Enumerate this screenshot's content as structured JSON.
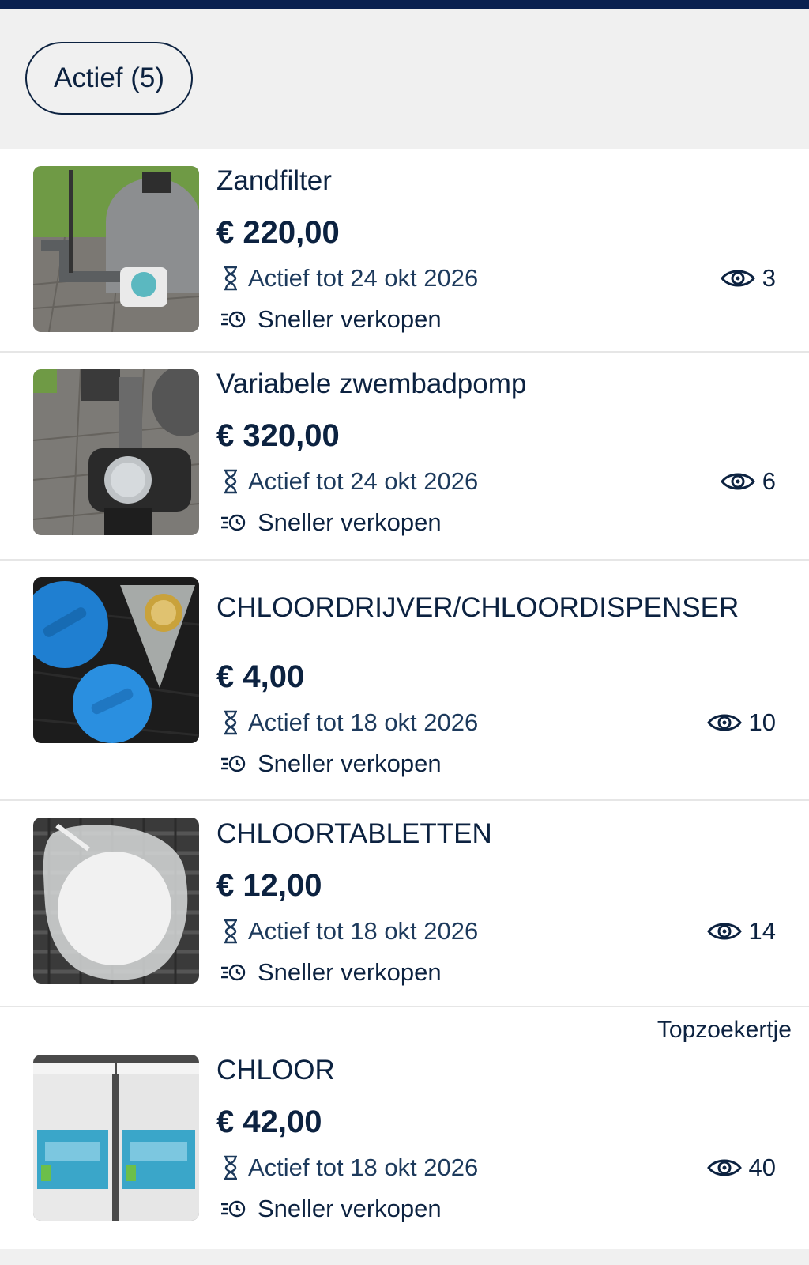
{
  "filter": {
    "active_chip": "Actief (5)"
  },
  "actions": {
    "sell_faster": "Sneller verkopen"
  },
  "listings": [
    {
      "title": "Zandfilter",
      "price": "€ 220,00",
      "active_until": "Actief tot 24 okt 2026",
      "views": "3"
    },
    {
      "title": "Variabele zwembadpomp",
      "price": "€ 320,00",
      "active_until": "Actief tot 24 okt 2026",
      "views": "6"
    },
    {
      "title": "CHLOORDRIJVER/CHLOORDISPENSER",
      "price": "€ 4,00",
      "active_until": "Actief tot 18 okt 2026",
      "views": "10"
    },
    {
      "title": "CHLOORTABLETTEN",
      "price": "€ 12,00",
      "active_until": "Actief tot 18 okt 2026",
      "views": "14"
    },
    {
      "title": "CHLOOR",
      "price": "€ 42,00",
      "active_until": "Actief tot 18 okt 2026",
      "views": "40",
      "badge": "Topzoekertje"
    }
  ],
  "colors": {
    "brand_navy": "#0a2150",
    "text": "#0c2240",
    "background": "#f0f0f0"
  },
  "icons": [
    "hourglass-icon",
    "eye-icon",
    "sell-faster-icon"
  ]
}
